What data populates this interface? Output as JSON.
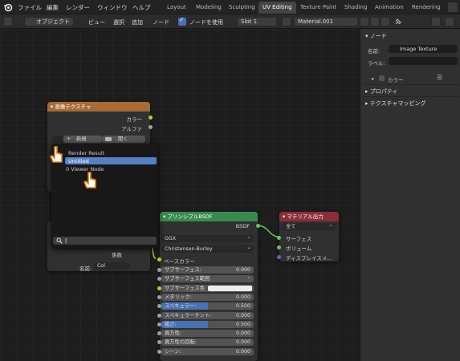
{
  "menubar": {
    "items": [
      "ファイル",
      "編集",
      "レンダー",
      "ウィンドウ",
      "ヘルプ"
    ],
    "workspaces": [
      "Layout",
      "Modeling",
      "Sculpting",
      "UV Editing",
      "Texture Paint",
      "Shading",
      "Animation",
      "Rendering"
    ],
    "active_workspace": "UV Editing"
  },
  "header": {
    "mode": "オブジェクト",
    "view": "ビュー",
    "select": "選択",
    "add": "追加",
    "node": "ノード",
    "use_nodes": "ノードを使用",
    "slot": "Slot 1",
    "material": "Material.001"
  },
  "image_texture_node": {
    "title": "画像テクスチャ",
    "out_color": "カラー",
    "out_alpha": "アルファ",
    "new_label": "新規",
    "open_label": "開く",
    "in_factor": "係数",
    "name_label": "名前:",
    "name_value": "Col"
  },
  "popup": {
    "items": [
      "Render Result",
      "Untitled",
      "0 Viewer Node"
    ],
    "highlighted": "Untitled",
    "search_value": "|"
  },
  "bsdf_node": {
    "title": "プリンシプルBSDF",
    "output": "BSDF",
    "distribution": "GGX",
    "subsurface_method": "Christensen-Burley",
    "base_color_label": "ベースカラー",
    "rows": [
      {
        "label": "サブサーフェス:",
        "value": "0.000",
        "fill": 0
      },
      {
        "label": "サブサーフェス範囲",
        "value": "",
        "fill": 0
      },
      {
        "label": "サブサーフェス色",
        "value": "",
        "fill": 0
      },
      {
        "label": "メタリック:",
        "value": "0.000",
        "fill": 0
      },
      {
        "label": "スペキュラー:",
        "value": "0.500",
        "fill": 0.5
      },
      {
        "label": "スペキュラーチント:",
        "value": "0.000",
        "fill": 0
      },
      {
        "label": "粗さ:",
        "value": "0.500",
        "fill": 0.5
      },
      {
        "label": "異方性:",
        "value": "0.000",
        "fill": 0
      },
      {
        "label": "異方性の回転:",
        "value": "0.000",
        "fill": 0
      },
      {
        "label": "シーン:",
        "value": "0.000",
        "fill": 0
      }
    ]
  },
  "output_node": {
    "title": "マテリアル出力",
    "target": "全て",
    "inputs": [
      "サーフェス",
      "ボリューム",
      "ディスプレイスメ..."
    ]
  },
  "panel": {
    "section_node": "ノード",
    "name_label": "名前:",
    "name_value": "Image Texture",
    "label_label": "ラベル:",
    "label_value": "",
    "color_label": "カラー",
    "properties": "プロパティ",
    "texture_mapping": "テクスチャマッピング"
  },
  "colors": {
    "accent": "#4772b3",
    "image_texture_header": "#a86b33",
    "bsdf_header": "#3a8a4f",
    "output_header": "#8a2f38"
  }
}
